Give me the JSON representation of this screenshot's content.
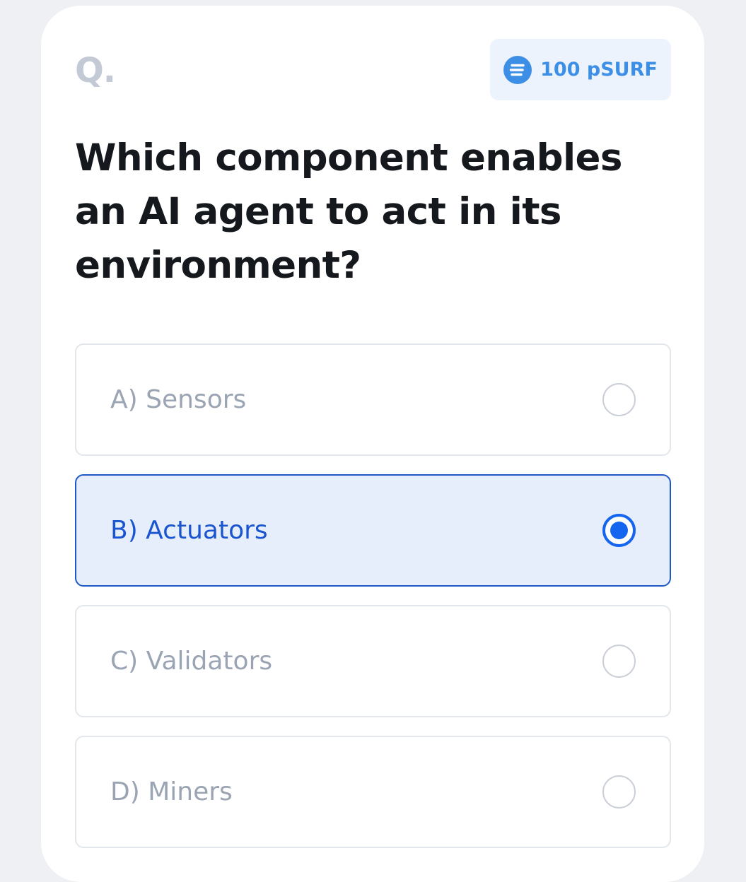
{
  "question": {
    "label": "Q.",
    "text": "Which component enables an AI agent to act in its environment?"
  },
  "reward": {
    "amount": "100 pSURF",
    "icon": "coin-icon"
  },
  "options": [
    {
      "label": "A) Sensors",
      "selected": false
    },
    {
      "label": "B) Actuators",
      "selected": true
    },
    {
      "label": "C) Validators",
      "selected": false
    },
    {
      "label": "D) Miners",
      "selected": false
    }
  ],
  "colors": {
    "accent": "#1565ee",
    "selected_background": "#e6eefb",
    "badge_background": "#ecf3fc",
    "badge_text": "#3d8fe6"
  }
}
